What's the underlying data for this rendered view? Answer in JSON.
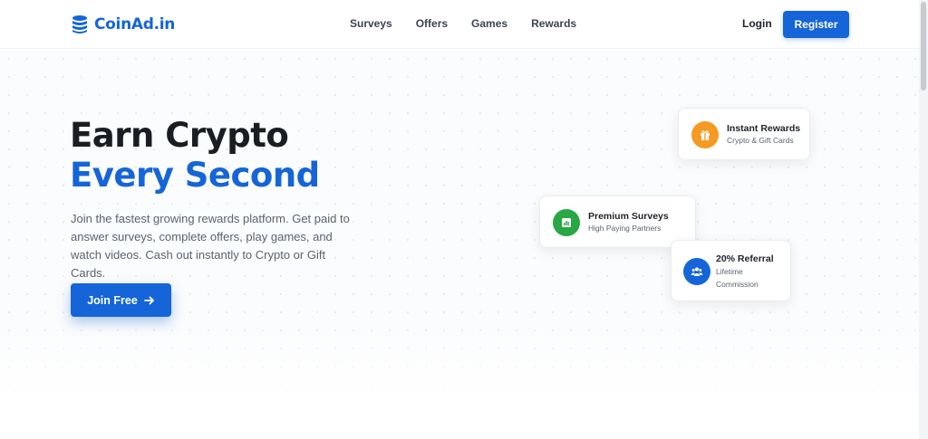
{
  "brand": {
    "name": "CoinAd.in",
    "logo_icon": "coin-stack-icon",
    "color": "#1565d8"
  },
  "nav": {
    "links": [
      "Surveys",
      "Offers",
      "Games",
      "Rewards"
    ],
    "login": "Login",
    "register": "Register"
  },
  "hero": {
    "headline_line1": "Earn Crypto",
    "headline_line2": "Every Second",
    "description": "Join the fastest growing rewards platform. Get paid to answer surveys, complete offers, play games, and watch videos. Cash out instantly to Crypto or Gift Cards.",
    "cta": "Join Free",
    "cta_icon": "arrow-right-icon"
  },
  "cards": [
    {
      "title": "Instant Rewards",
      "subtitle": "Crypto & Gift Cards",
      "icon": "gift-icon",
      "color": "#f59a23"
    },
    {
      "title": "Premium Surveys",
      "subtitle": "High Paying Partners",
      "icon": "chart-icon",
      "color": "#28a745"
    },
    {
      "title": "20% Referral",
      "subtitle": "Lifetime Commission",
      "icon": "users-icon",
      "color": "#1565d8"
    }
  ]
}
